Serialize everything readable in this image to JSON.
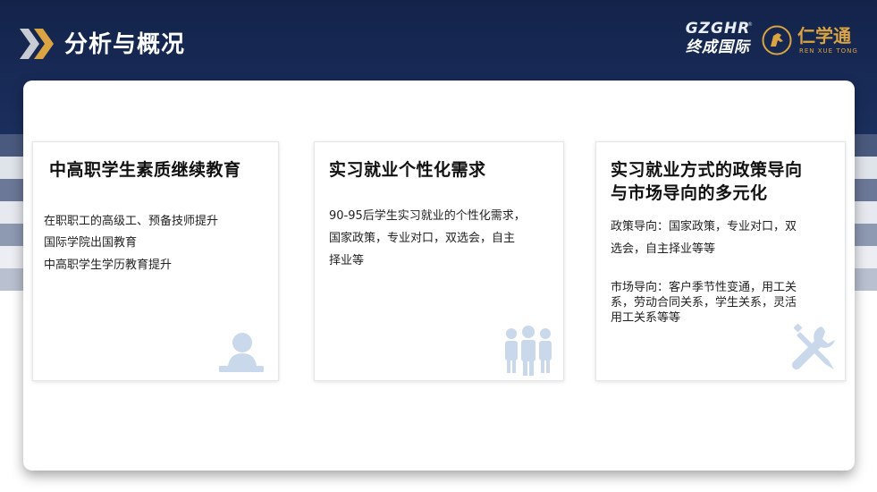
{
  "header": {
    "title": "分析与概况"
  },
  "logos": {
    "gzghr_mark": "GZGHR",
    "gzghr_cn": "终成国际",
    "gzghr_registered": "®",
    "rxt_cn": "仁学通",
    "rxt_en": "REN XUE TONG"
  },
  "cards": [
    {
      "title": "中高职学生素质继续教育",
      "lines": [
        "在职职工的高级工、预备技师提升",
        "国际学院出国教育",
        "中高职学生学历教育提升"
      ],
      "icon": "person-at-desk-icon"
    },
    {
      "title": "实习就业个性化需求",
      "lines": [
        "90-95后学生实习就业的个性化需求，",
        "国家政策，专业对口，双选会，自主",
        "择业等"
      ],
      "icon": "group-people-icon"
    },
    {
      "title_lines": [
        "实习就业方式的政策导向",
        "与市场导向的多元化"
      ],
      "policy_lines": [
        "政策导向：国家政策，专业对口，双",
        "选会，自主择业等等"
      ],
      "market_lines": [
        "市场导向：客户季节性变通，用工关",
        "系，劳动合同关系，学生关系，灵活",
        "用工关系等等"
      ],
      "icon": "wrench-screwdriver-icon"
    }
  ],
  "colors": {
    "header_bg": "#13234a",
    "accent_gold": "#d9a441",
    "stripe_dark": "#4a5a7e",
    "stripe_light": "#e9ecf1",
    "watermark_icon": "#c9d8ea"
  }
}
